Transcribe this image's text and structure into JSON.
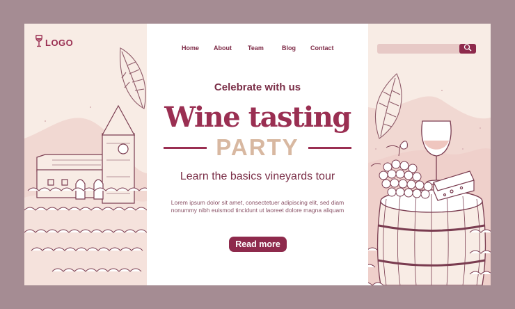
{
  "header": {
    "logo_text": "LOGO",
    "logo_icon": "wine-glass-icon",
    "nav": [
      {
        "label": "Home"
      },
      {
        "label": "About"
      },
      {
        "label": "Team"
      },
      {
        "label": "Blog"
      },
      {
        "label": "Contact"
      }
    ],
    "search": {
      "placeholder": "",
      "icon": "search-icon"
    }
  },
  "hero": {
    "subtitle": "Celebrate with us",
    "title": "Wine tasting",
    "title_highlight": "PARTY",
    "tagline": "Learn the basics vineyards tour",
    "body": "Lorem ipsum dolor sit amet, consectetuer adipiscing elit, sed diam nonummy nibh euismod tincidunt ut laoreet dolore magna aliquam",
    "cta_label": "Read more"
  },
  "colors": {
    "background": "#a58c93",
    "page": "#f8ece5",
    "accent": "#9a2f52",
    "highlight": "#d8b8a1"
  }
}
